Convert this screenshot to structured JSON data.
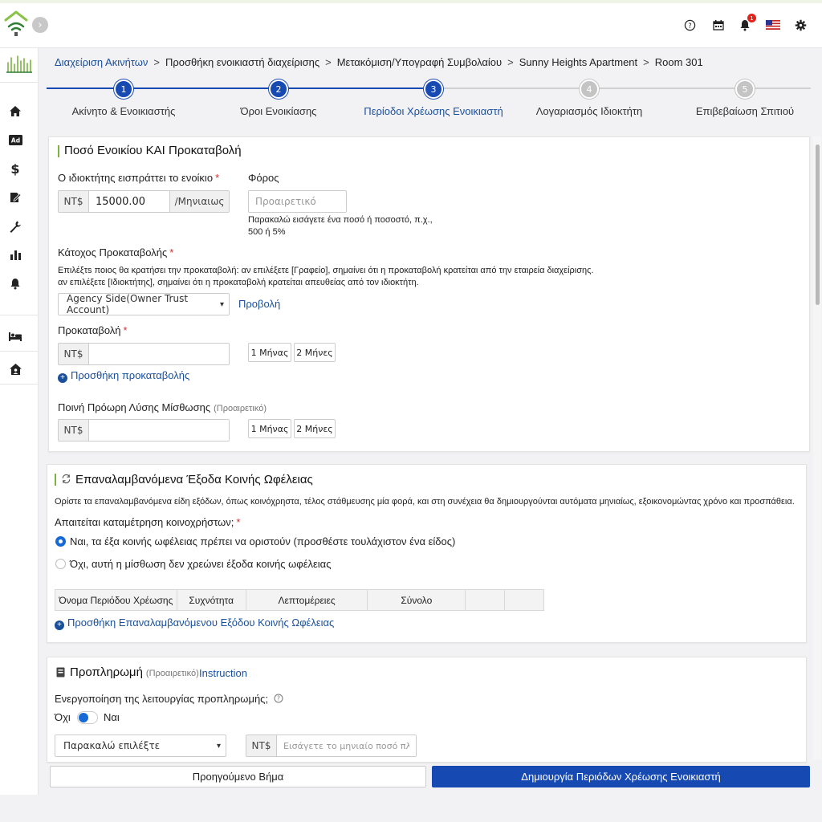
{
  "breadcrumb": {
    "items": [
      "Διαχείριση Ακινήτων",
      "Προσθήκη ενοικιαστή διαχείρισης",
      "Μετακόμιση/Υπογραφή Συμβολαίου",
      "Sunny Heights Apartment",
      "Room 301"
    ],
    "separator": ">"
  },
  "header": {
    "notification_count": "1"
  },
  "steps": [
    {
      "number": "1",
      "label": "Ακίνητο & Ενοικιαστής"
    },
    {
      "number": "2",
      "label": "Όροι Ενοικίασης"
    },
    {
      "number": "3",
      "label": "Περίοδοι Χρέωσης Ενοικιαστή"
    },
    {
      "number": "4",
      "label": "Λογαριασμός Ιδιοκτήτη"
    },
    {
      "number": "5",
      "label": "Επιβεβαίωση Σπιτιού"
    }
  ],
  "current_step": 3,
  "rent_section": {
    "title": "Ποσό Ενοικίου ΚΑΙ Προκαταβολή",
    "rent_label": "Ο ιδιοκτήτης εισπράττει το ενοίκιο",
    "currency": "NT$",
    "rent_value": "15000.00",
    "period": "/Μηνιαιως",
    "tax_label": "Φόρος",
    "tax_placeholder": "Προαιρετικό",
    "tax_hint": "Παρακαλώ εισάγετε ένα ποσό ή ποσοστό, π.χ., 500 ή 5%",
    "holder_label": "Κάτοχος Προκαταβολής",
    "holder_hint_1": "Επιλέξτs ποιος θα κρατήσει την προκαταβολή: αν επιλέξετε [Γραφείο], σημαίνει ότι η προκαταβολή κρατείται από την εταιρεία διαχείρισης.",
    "holder_hint_2": "αν επιλέξετε [Ιδιοκτήτης], σημαίνει ότι η προκαταβολή κρατείται απευθείας από τον ιδιοκτήτη.",
    "holder_value": "Agency Side(Owner Trust Account)",
    "view_link": "Προβολή",
    "deposit_label": "Προκαταβολή",
    "month_1": "1 Μήνας",
    "month_2": "2 Μήνες",
    "add_deposit": "Προσθήκη προκαταβολής",
    "penalty_label": "Ποινή Πρόωρη Λύσης Μίσθωσης",
    "optional": "(Προαιρετικό)"
  },
  "utility_section": {
    "title": "Επαναλαμβανόμενα Έξοδα Κοινής Ωφέλειας",
    "description": "Ορίστε τα επαναλαμβανόμενα είδη εξόδων, όπως κοινόχρηστα, τέλος στάθμευσης μία φορά, και στη συνέχεια θα δημιουργούνται αυτόματα μηνιαίως, εξοικονομώντας χρόνο και προσπάθεια.",
    "question": "Απαιτείται καταμέτρηση κοινοχρήστων;",
    "option_yes": "Ναι, τα έξα κοινής ωφέλειας πρέπει να οριστούν (προσθέστε τουλάχιστον ένα είδος)",
    "option_no": "Όχι, αυτή η μίσθωση δεν χρεώνει έξοδα κοινής ωφέλειας",
    "columns": [
      "Όνομα Περιόδου Χρέωσης",
      "Συχνότητα",
      "Λεπτομέρειες",
      "Σύνολο",
      "",
      ""
    ],
    "add_link": "Προσθήκη Επαναλαμβανόμενου Εξόδου Κοινής Ωφέλειας"
  },
  "prepay_section": {
    "title": "Προπληρωμή",
    "optional": "(Προαιρετικό)",
    "instruction": "Instruction",
    "enable_label": "Ενεργοποίηση της λειτουργίας προπληρωμής;",
    "no_label": "Όχι",
    "yes_label": "Ναι",
    "select_placeholder": "Παρακαλώ επιλέξτε",
    "currency": "NT$",
    "amount_placeholder": "Εισάγετε το μηνιαίο ποσό πληρωμής"
  },
  "footer": {
    "prev_label": "Προηγούμενο Βήμα",
    "next_label": "Δημιουργία Περιόδων Χρέωσης Ενοικιαστή"
  },
  "colors": {
    "primary": "#1749b3",
    "link": "#1a4f9c",
    "accent_bar": "#7cb342",
    "required": "#d32f2f"
  }
}
